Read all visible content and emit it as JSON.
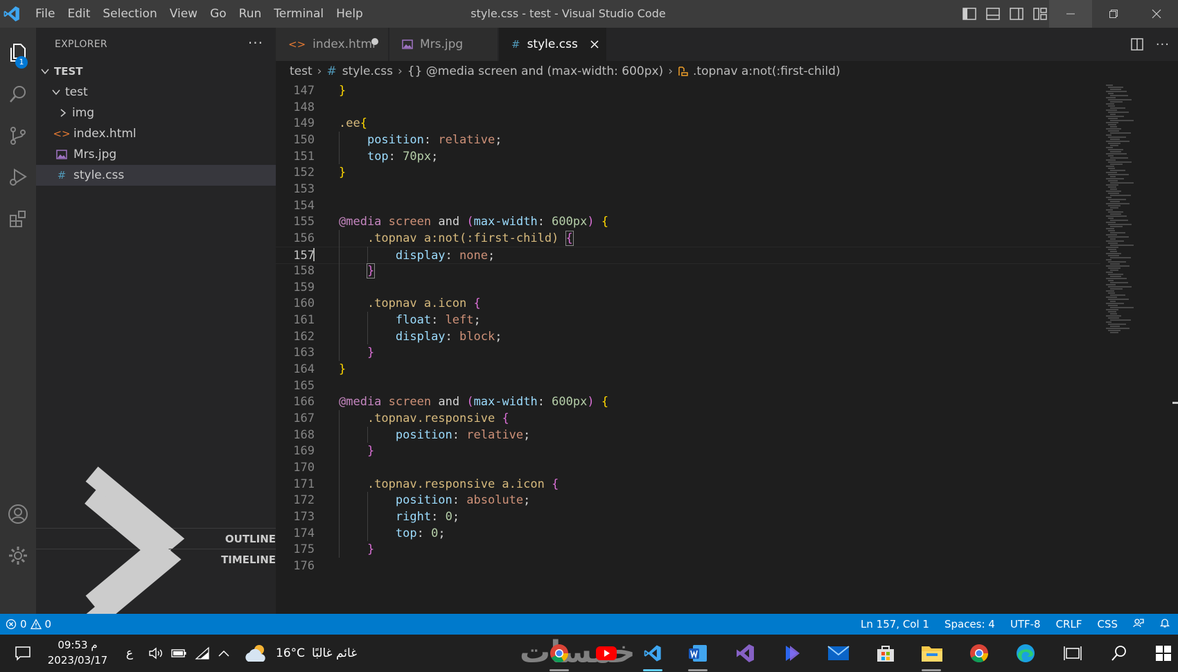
{
  "window": {
    "title": "style.css - test - Visual Studio Code"
  },
  "menu": [
    "File",
    "Edit",
    "Selection",
    "View",
    "Go",
    "Run",
    "Terminal",
    "Help"
  ],
  "activity": {
    "explorer_badge": "1"
  },
  "sidebar": {
    "header": "EXPLORER",
    "more": "···",
    "root": "TEST",
    "items": [
      {
        "label": "test",
        "indent": 1,
        "type": "folder-open"
      },
      {
        "label": "img",
        "indent": 2,
        "type": "folder"
      },
      {
        "label": "index.html",
        "indent": 2,
        "type": "html"
      },
      {
        "label": "Mrs.jpg",
        "indent": 2,
        "type": "image"
      },
      {
        "label": "style.css",
        "indent": 2,
        "type": "css"
      }
    ],
    "outline": "OUTLINE",
    "timeline": "TIMELINE"
  },
  "tabs": [
    {
      "label": "index.html",
      "icon": "<>",
      "modified": true
    },
    {
      "label": "Mrs.jpg",
      "icon": "img",
      "modified": false
    },
    {
      "label": "style.css",
      "icon": "#",
      "active": true
    }
  ],
  "breadcrumb": {
    "folder": "test",
    "file": "style.css",
    "media": "{} @media screen and (max-width: 600px)",
    "selector": ".topnav a:not(:first-child)"
  },
  "editor": {
    "current_line": 157,
    "lines": [
      {
        "n": "147",
        "html": "<span class='t-b1'>}</span>"
      },
      {
        "n": "148",
        "html": ""
      },
      {
        "n": "149",
        "html": "<span class='t-sel'>.ee</span><span class='t-b1'>{</span>"
      },
      {
        "n": "150",
        "html": "    <span class='t-prop'>position</span>: <span class='t-val'>relative</span>;"
      },
      {
        "n": "151",
        "html": "    <span class='t-prop'>top</span>: <span class='t-num'>70px</span>;"
      },
      {
        "n": "152",
        "html": "<span class='t-b1'>}</span>"
      },
      {
        "n": "153",
        "html": ""
      },
      {
        "n": "154",
        "html": ""
      },
      {
        "n": "155",
        "html": "<span class='t-at'>@media</span> <span class='t-val'>screen</span> <span class='t-kw'>and</span> <span class='t-b2'>(</span><span class='t-prop'>max-width</span>: <span class='t-num'>600px</span><span class='t-b2'>)</span> <span class='t-b1'>{</span>"
      },
      {
        "n": "156",
        "html": "    <span class='t-sel'>.topnav a:not(:first-child)</span> <span class='t-b2 box'>{</span>"
      },
      {
        "n": "157",
        "html": "        <span class='t-prop'>display</span>: <span class='t-val'>none</span>;"
      },
      {
        "n": "158",
        "html": "    <span class='t-b2 box'>}</span>"
      },
      {
        "n": "159",
        "html": ""
      },
      {
        "n": "160",
        "html": "    <span class='t-sel'>.topnav a.icon</span> <span class='t-b2'>{</span>"
      },
      {
        "n": "161",
        "html": "        <span class='t-prop'>float</span>: <span class='t-val'>left</span>;"
      },
      {
        "n": "162",
        "html": "        <span class='t-prop'>display</span>: <span class='t-val'>block</span>;"
      },
      {
        "n": "163",
        "html": "    <span class='t-b2'>}</span>"
      },
      {
        "n": "164",
        "html": "<span class='t-b1'>}</span>"
      },
      {
        "n": "165",
        "html": ""
      },
      {
        "n": "166",
        "html": "<span class='t-at'>@media</span> <span class='t-val'>screen</span> <span class='t-kw'>and</span> <span class='t-b2'>(</span><span class='t-prop'>max-width</span>: <span class='t-num'>600px</span><span class='t-b2'>)</span> <span class='t-b1'>{</span>"
      },
      {
        "n": "167",
        "html": "    <span class='t-sel'>.topnav.responsive</span> <span class='t-b2'>{</span>"
      },
      {
        "n": "168",
        "html": "        <span class='t-prop'>position</span>: <span class='t-val'>relative</span>;"
      },
      {
        "n": "169",
        "html": "    <span class='t-b2'>}</span>"
      },
      {
        "n": "170",
        "html": ""
      },
      {
        "n": "171",
        "html": "    <span class='t-sel'>.topnav.responsive a.icon</span> <span class='t-b2'>{</span>"
      },
      {
        "n": "172",
        "html": "        <span class='t-prop'>position</span>: <span class='t-val'>absolute</span>;"
      },
      {
        "n": "173",
        "html": "        <span class='t-prop'>right</span>: <span class='t-num'>0</span>;"
      },
      {
        "n": "174",
        "html": "        <span class='t-prop'>top</span>: <span class='t-num'>0</span>;"
      },
      {
        "n": "175",
        "html": "    <span class='t-b2'>}</span>"
      },
      {
        "n": "176",
        "html": ""
      }
    ]
  },
  "status": {
    "errors": "0",
    "warnings": "0",
    "position": "Ln 157, Col 1",
    "spaces": "Spaces: 4",
    "encoding": "UTF-8",
    "eol": "CRLF",
    "language": "CSS"
  },
  "taskbar": {
    "time": "09:53 م",
    "date": "2023/03/17",
    "lang": "ع",
    "temperature": "16°C",
    "weather": "غائم غالبًا",
    "watermark": "خمسات"
  },
  "colors": {
    "accent": "#007acc",
    "titlebar": "#3c3c3c",
    "editor_bg": "#1e1e1e"
  }
}
